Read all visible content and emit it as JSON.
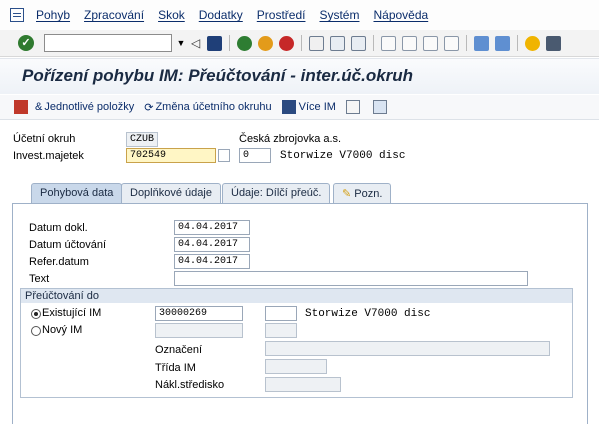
{
  "menu": {
    "items": [
      "Pohyb",
      "Zpracování",
      "Skok",
      "Dodatky",
      "Prostředí",
      "Systém",
      "Nápověda"
    ]
  },
  "system_toolbar": {
    "command_value": ""
  },
  "title": "Pořízení pohybu IM: Přeúčtování - inter.úč.okruh",
  "app_toolbar": {
    "single_items": "Jednotlivé položky",
    "change_company": "Změna účetního okruhu",
    "more_im": "Více IM"
  },
  "header": {
    "company_label": "Účetní okruh",
    "company_value": "CZUB",
    "company_name": "Česká zbrojovka a.s.",
    "asset_label": "Invest.majetek",
    "asset_value": "702549",
    "subnumber_value": "0",
    "asset_desc": "Storwize V7000 disc"
  },
  "tabs": [
    {
      "label": "Pohybová data",
      "active": true
    },
    {
      "label": "Doplňkové údaje",
      "active": false
    },
    {
      "label": "Údaje: Dílčí přeúč.",
      "active": false
    },
    {
      "label": "Pozn.",
      "active": false
    }
  ],
  "form": {
    "doc_date_label": "Datum dokl.",
    "doc_date_value": "04.04.2017",
    "posting_date_label": "Datum účtování",
    "posting_date_value": "04.04.2017",
    "ref_date_label": "Refer.datum",
    "ref_date_value": "04.04.2017",
    "text_label": "Text",
    "text_value": ""
  },
  "transfer": {
    "group_label": "Přeúčtování do",
    "existing_label": "Existující IM",
    "existing_value": "30000269",
    "existing_sub": "",
    "existing_desc": "Storwize V7000 disc",
    "new_label": "Nový IM",
    "description_label": "Označení",
    "class_label": "Třída IM",
    "cost_center_label": "Nákl.středisko"
  }
}
